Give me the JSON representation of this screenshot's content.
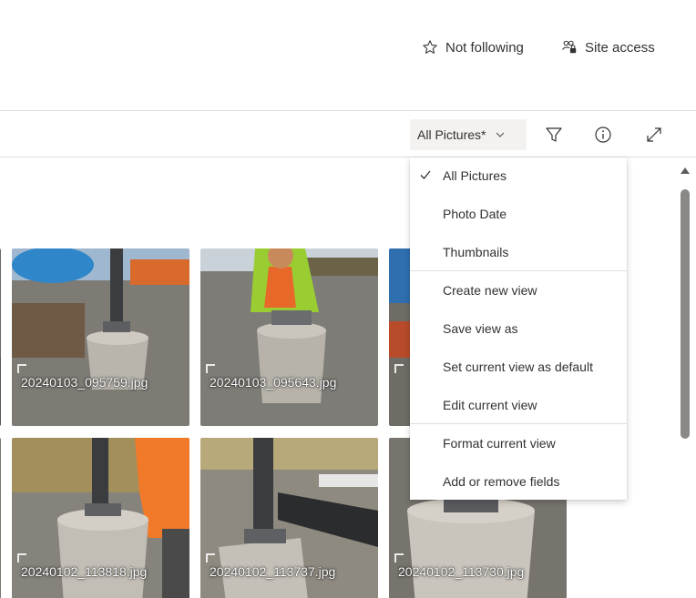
{
  "header": {
    "follow_label": "Not following",
    "site_access_label": "Site access"
  },
  "command_bar": {
    "view_label": "All Pictures*"
  },
  "view_menu": {
    "items": [
      {
        "label": "All Pictures",
        "checked": true
      },
      {
        "label": "Photo Date"
      },
      {
        "label": "Thumbnails"
      },
      {
        "label": "Create new view"
      },
      {
        "label": "Save view as"
      },
      {
        "label": "Set current view as default"
      },
      {
        "label": "Edit current view"
      },
      {
        "label": "Format current view"
      },
      {
        "label": "Add or remove fields"
      }
    ]
  },
  "gallery": {
    "items": [
      {
        "name": "20240103_095759.jpg"
      },
      {
        "name": "20240103_095643.jpg"
      },
      {
        "name": "20240102_113818.jpg"
      },
      {
        "name": "20240102_113737.jpg"
      },
      {
        "name": "20240102_113730.jpg"
      }
    ]
  },
  "colors": {
    "accent": "#0078d4",
    "text": "#323130",
    "divider": "#e1dfdd"
  }
}
